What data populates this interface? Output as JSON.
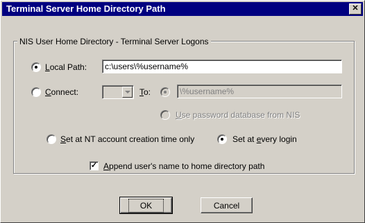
{
  "window": {
    "title": "Terminal Server Home Directory Path",
    "close_glyph": "✕"
  },
  "group": {
    "legend": "NIS User Home Directory - Terminal Server Logons"
  },
  "local_path": {
    "selected": true,
    "label_underlined": "L",
    "label_rest": "ocal Path:",
    "value": "c:\\users\\%username%"
  },
  "connect": {
    "selected": false,
    "label_underlined": "C",
    "label_rest": "onnect:",
    "drive_value": "",
    "to_label_underlined": "T",
    "to_label_rest": "o:",
    "to_value": "\\%username%",
    "use_nis_underlined": "U",
    "use_nis_rest": "se password database from NIS"
  },
  "timing": {
    "nt_creation_underlined": "S",
    "nt_creation_rest": "et at NT account creation time only",
    "nt_creation_selected": false,
    "every_login_prefix": "Set at ",
    "every_login_underlined": "e",
    "every_login_rest": "very login",
    "every_login_selected": true
  },
  "append": {
    "checked": true,
    "check_glyph": "✓",
    "label_underlined": "A",
    "label_rest": "ppend user's name to home directory path"
  },
  "buttons": {
    "ok": "OK",
    "cancel": "Cancel"
  }
}
